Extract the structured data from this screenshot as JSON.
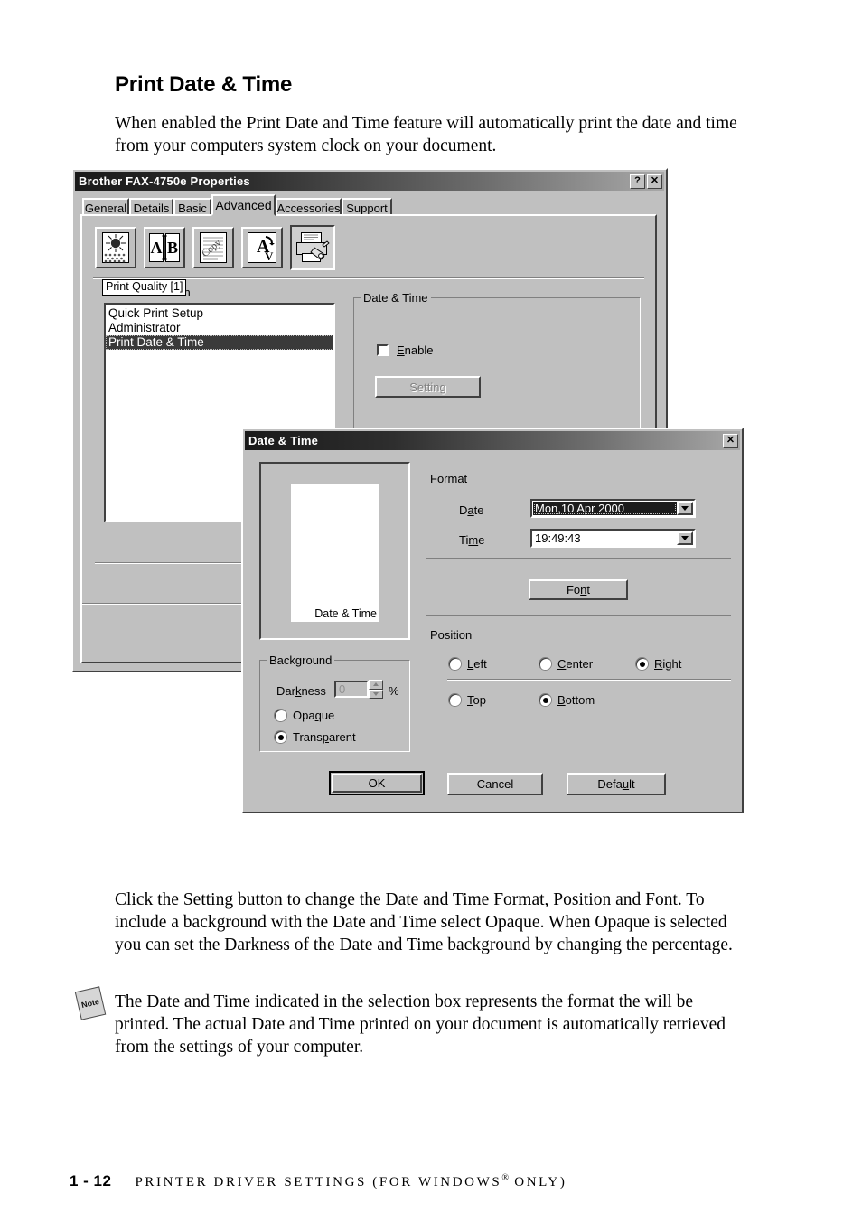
{
  "page": {
    "heading": "Print Date & Time",
    "intro_paragraph": "When enabled the Print Date and Time feature will automatically print the date and time from your computers system clock on your document.",
    "click_paragraph": "Click the Setting button to change the Date and Time Format, Position and Font. To include a background with the Date and Time select Opaque. When Opaque is selected you can set the Darkness of the Date and Time background by changing the percentage.",
    "note_label": "Note",
    "note_paragraph": "The Date and Time indicated in the selection box represents the format the will be printed. The actual Date and Time printed on your document is automatically retrieved from the settings of your computer.",
    "footer_page": "1 - 12",
    "footer_text_before": "PRINTER DRIVER SETTINGS (FOR WINDOWS",
    "footer_superscript": "®",
    "footer_text_after": "ONLY)"
  },
  "properties_dialog": {
    "title": "Brother FAX-4750e Properties",
    "help_button": "?",
    "close_button": "✕",
    "tabs": [
      {
        "label": "General",
        "active": false
      },
      {
        "label": "Details",
        "active": false
      },
      {
        "label": "Basic",
        "active": false
      },
      {
        "label": "Advanced",
        "active": true
      },
      {
        "label": "Accessories",
        "active": false
      },
      {
        "label": "Support",
        "active": false
      }
    ],
    "toolbar_buttons": [
      {
        "name": "print-quality-icon",
        "pressed": false
      },
      {
        "name": "multiple-page-icon",
        "pressed": false
      },
      {
        "name": "watermark-icon",
        "pressed": false
      },
      {
        "name": "page-scaling-icon",
        "pressed": false
      },
      {
        "name": "printer-function-icon",
        "pressed": true
      }
    ],
    "tooltip": "Print Quality [1]",
    "section_label": "Printer Function",
    "function_list": [
      {
        "label": "Quick Print Setup",
        "selected": false
      },
      {
        "label": "Administrator",
        "selected": false
      },
      {
        "label": "Print Date & Time",
        "selected": true
      }
    ],
    "date_time_group": {
      "legend": "Date & Time",
      "enable_label": "Enable",
      "enable_checked": false,
      "setting_button": "Setting",
      "setting_disabled": true
    }
  },
  "date_time_dialog": {
    "title": "Date & Time",
    "close_button": "✕",
    "preview_text": "Date & Time",
    "format": {
      "legend": "Format",
      "date_label": "Date",
      "date_label_pre": "D",
      "date_label_accel": "a",
      "date_label_post": "te",
      "date_value": "Mon,10 Apr 2000",
      "time_label_pre": "Ti",
      "time_label_accel": "m",
      "time_label_post": "e",
      "time_value": "19:49:43"
    },
    "font_button": "Font",
    "position": {
      "legend": "Position",
      "options": [
        {
          "label": "Left",
          "accel": "L",
          "selected": false
        },
        {
          "label": "Center",
          "accel": "C",
          "selected": false
        },
        {
          "label": "Right",
          "accel": "R",
          "selected": true
        },
        {
          "label": "Top",
          "accel": "T",
          "selected": false
        },
        {
          "label": "Bottom",
          "accel": "B",
          "selected": true
        }
      ]
    },
    "background": {
      "legend": "Background",
      "darkness_label": "Darkness",
      "darkness_value": "0",
      "percent_symbol": "%",
      "darkness_disabled": true,
      "opaque_label": "Opaque",
      "opaque_selected": false,
      "transparent_label": "Transparent",
      "transparent_selected": true
    },
    "buttons": {
      "ok": "OK",
      "cancel": "Cancel",
      "default": "Default"
    }
  },
  "colors": {
    "dialog_face": "#c0c0c0",
    "titlebar_dark": "#1a1a1a",
    "selection": "#3a3a3a",
    "disabled_text": "#808080"
  }
}
